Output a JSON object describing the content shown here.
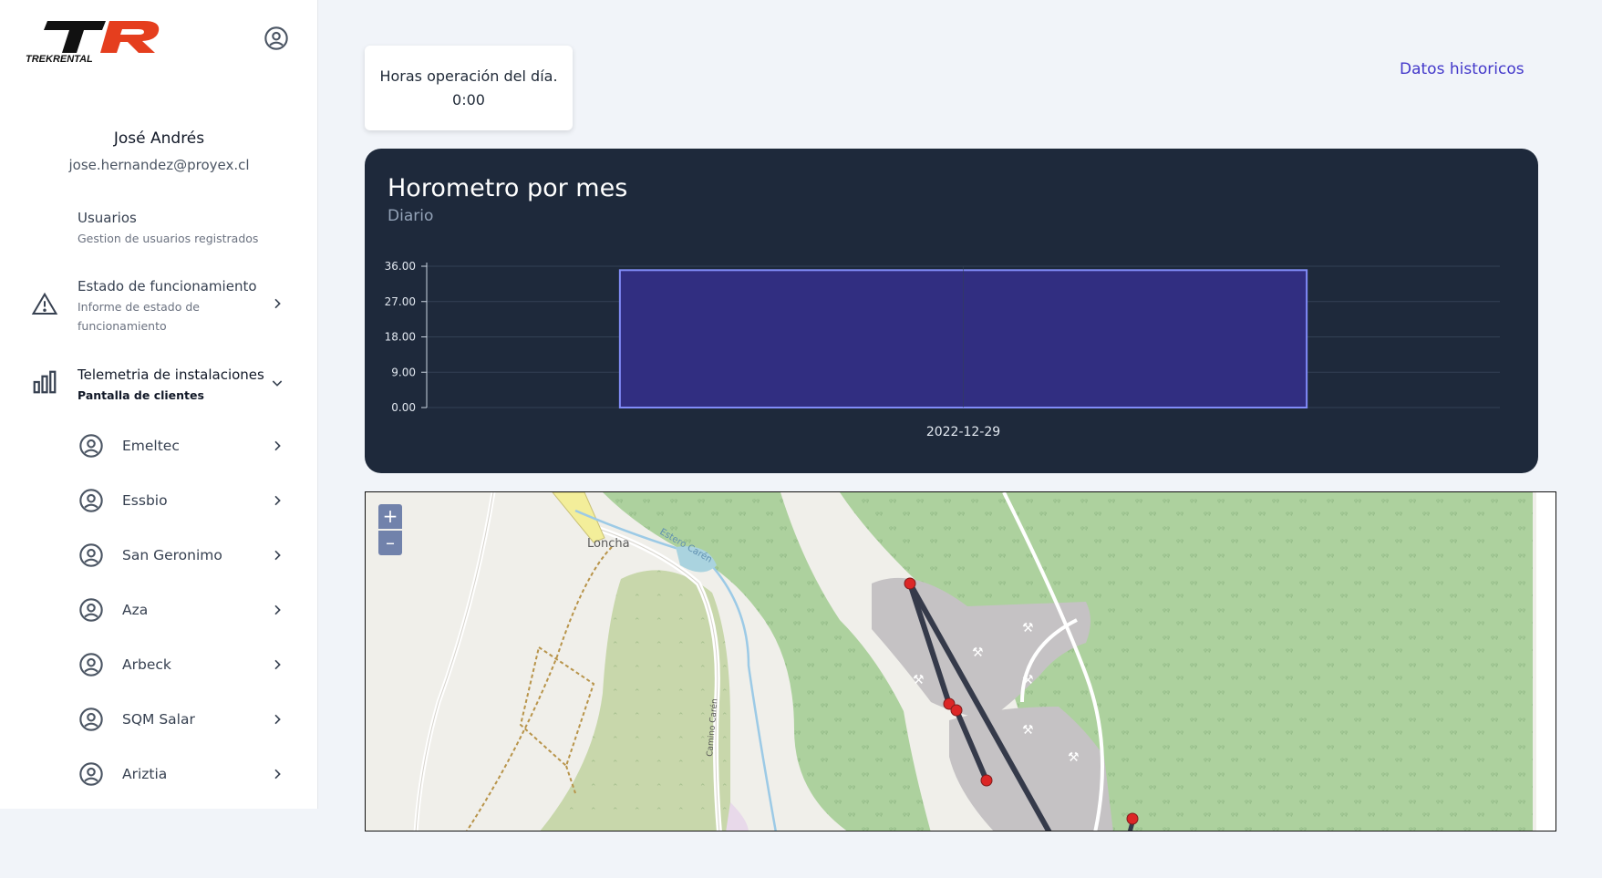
{
  "brand": {
    "logo_text_top": "TR",
    "logo_text_bottom": "TREKRENTAL"
  },
  "profile": {
    "name": "José Andrés",
    "email": "jose.hernandez@proyex.cl"
  },
  "nav": {
    "usuarios": {
      "title": "Usuarios",
      "subtitle": "Gestion de usuarios registrados"
    },
    "estado": {
      "title": "Estado de funcionamiento",
      "subtitle": "Informe de estado de funcionamiento"
    },
    "telemetria": {
      "title": "Telemetria de instalaciones",
      "subtitle": "Pantalla de clientes"
    }
  },
  "clients": [
    "Emeltec",
    "Essbio",
    "San Geronimo",
    "Aza",
    "Arbeck",
    "SQM Salar",
    "Ariztia"
  ],
  "stat": {
    "label": "Horas operación del día.",
    "value": "0:00"
  },
  "historic_link": "Datos historicos",
  "chart_data": {
    "type": "bar",
    "title": "Horometro por mes",
    "subtitle": "Diario",
    "categories": [
      "2022-12-29"
    ],
    "values": [
      35
    ],
    "yticks": [
      "0.00",
      "9.00",
      "18.00",
      "27.00",
      "36.00"
    ],
    "ylim": [
      0,
      36
    ],
    "grid": true,
    "bar_color": "#312e81",
    "bar_border": "#818cf8"
  },
  "map": {
    "zoom_in": "+",
    "zoom_out": "–",
    "labels": {
      "town": "Loncha",
      "creek": "Estero Carén",
      "road": "Camino Carén"
    }
  },
  "colors": {
    "accent": "#4338ca",
    "chart_bg": "#1e293b",
    "marker": "#dc2626"
  }
}
